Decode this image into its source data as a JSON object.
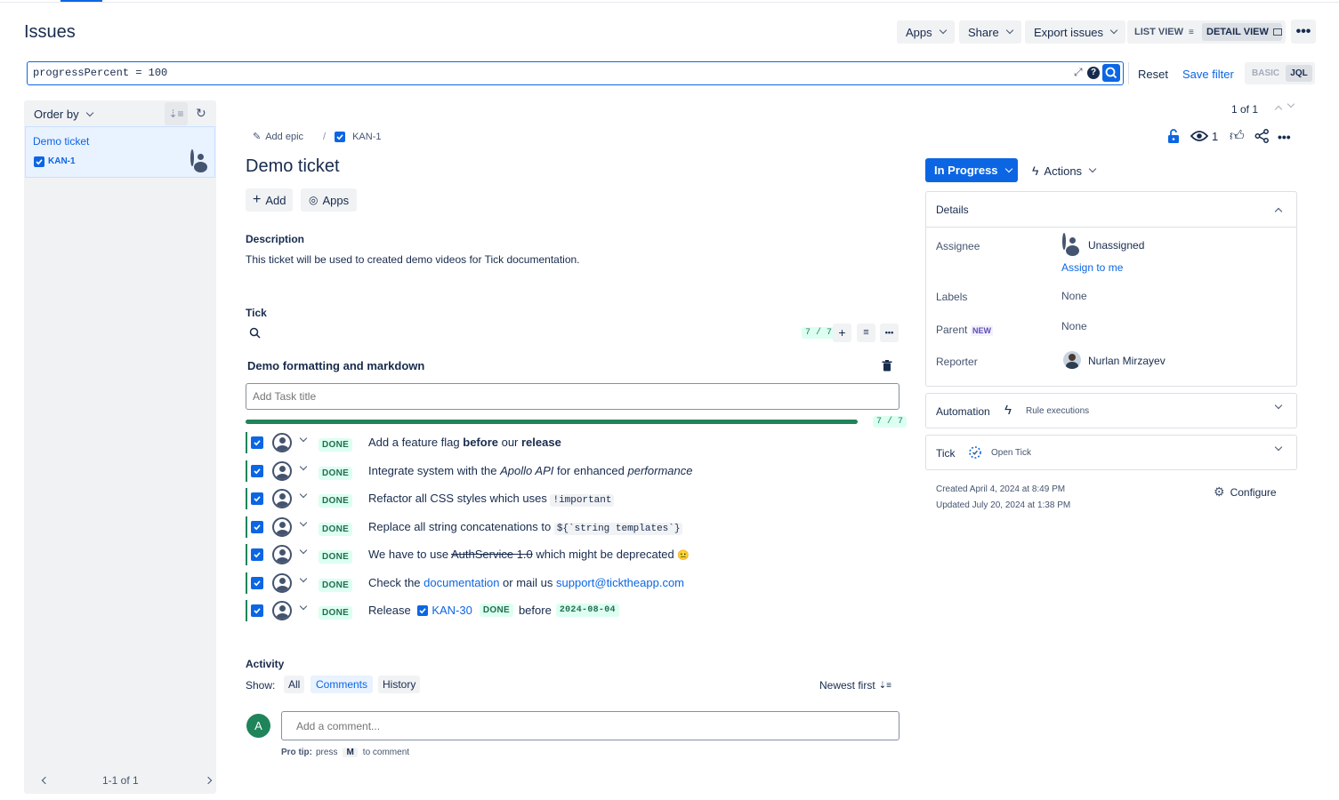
{
  "header": {
    "title": "Issues",
    "apps": "Apps",
    "share": "Share",
    "export": "Export issues",
    "list_view": "LIST VIEW",
    "detail_view": "DETAIL VIEW"
  },
  "search": {
    "query": "progressPercent = 100",
    "reset": "Reset",
    "save_filter": "Save filter",
    "basic": "BASIC",
    "jql": "JQL"
  },
  "sidebar": {
    "order_by": "Order by",
    "issue_title": "Demo ticket",
    "issue_key": "KAN-1",
    "pagination": "1-1 of 1"
  },
  "issue": {
    "counter": "1 of 1",
    "add_epic": "Add epic",
    "breadcrumb_sep": "/",
    "key": "KAN-1",
    "title": "Demo ticket",
    "add": "Add",
    "apps": "Apps",
    "watchers": "1",
    "description_label": "Description",
    "description": "This ticket will be used to created demo videos for Tick documentation."
  },
  "tick": {
    "label": "Tick",
    "count": "7 / 7",
    "checklist_title": "Demo formatting and markdown",
    "add_task_placeholder": "Add Task title",
    "progress_label": "7 / 7",
    "progress_fraction": 1.0,
    "done": "DONE",
    "tasks": [
      {
        "a": "Add a feature flag ",
        "b": "before",
        "c": " our ",
        "d": "release"
      },
      {
        "a": "Integrate system with the ",
        "b": "Apollo API",
        "c": " for enhanced ",
        "d": "performance"
      },
      {
        "a": "Refactor all CSS styles which uses ",
        "code": "!important"
      },
      {
        "a": "Replace all string concatenations to ",
        "code": "${`string templates`}"
      },
      {
        "a": "We have to use ",
        "strike": "AuthService 1.0",
        "c": " which might be deprecated ",
        "emoji": "😐"
      },
      {
        "a": "Check the ",
        "link1": "documentation",
        "c": " or mail us ",
        "link2": "support@ticktheapp.com"
      },
      {
        "a": "Release ",
        "link1": "KAN-30",
        "c": "before",
        "date": "2024-08-04"
      }
    ]
  },
  "activity": {
    "label": "Activity",
    "show": "Show:",
    "all": "All",
    "comments": "Comments",
    "history": "History",
    "sort": "Newest first",
    "avatar_letter": "A",
    "comment_placeholder": "Add a comment...",
    "pro_tip": "Pro tip:",
    "press": "press",
    "key": "M",
    "to_comment": "to comment"
  },
  "right": {
    "status": "In Progress",
    "actions": "Actions",
    "details": "Details",
    "assignee_label": "Assignee",
    "assignee": "Unassigned",
    "assign_to_me": "Assign to me",
    "labels_label": "Labels",
    "labels": "None",
    "parent_label": "Parent",
    "parent_badge": "NEW",
    "parent": "None",
    "reporter_label": "Reporter",
    "reporter": "Nurlan Mirzayev",
    "automation": "Automation",
    "rule_executions": "Rule executions",
    "tick": "Tick",
    "open_tick": "Open Tick",
    "created": "Created April 4, 2024 at 8:49 PM",
    "updated": "Updated July 20, 2024 at 1:38 PM",
    "configure": "Configure"
  },
  "colors": {
    "accent": "#0c66e4",
    "success": "#1f845a"
  }
}
